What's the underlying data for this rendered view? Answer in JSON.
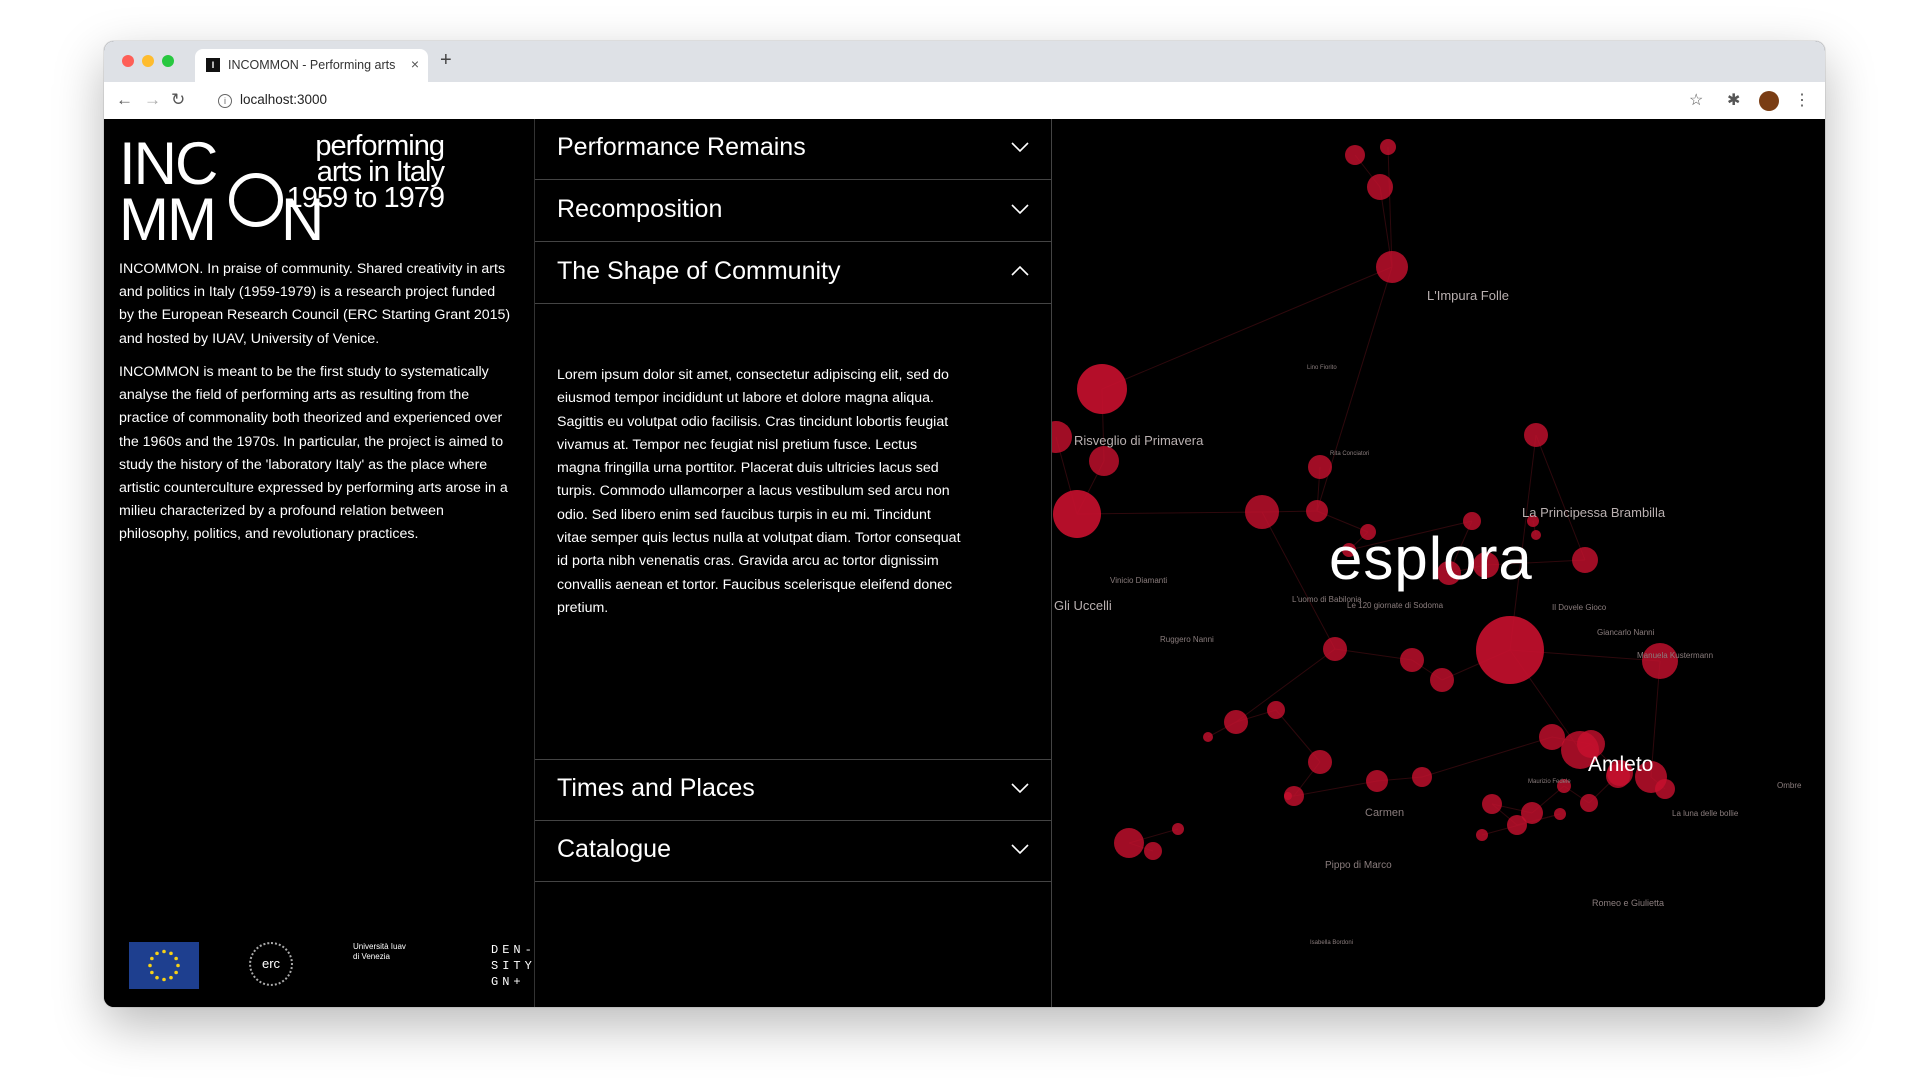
{
  "browser": {
    "tab_favicon": "I",
    "tab_title": "INCOMMON - Performing arts",
    "tab_close": "×",
    "new_tab": "+",
    "url": "localhost:3000"
  },
  "logo": {
    "line1": "INC",
    "line1b": "O",
    "line2a": "MM",
    "line2b": "N",
    "tagline": "performing arts in Italy 1959 to 1979"
  },
  "intro": {
    "paragraph1": "INCOMMON. In praise of community. Shared creativity in arts and politics in Italy (1959-1979) is a research project funded by the European Research Council (ERC Starting Grant 2015) and hosted by IUAV, University of Venice.",
    "paragraph2": "INCOMMON is meant to be the first study to systematically analyse the field of performing arts as resulting from the practice of commonality both theorized and experienced over the 1960s and the 1970s. In particular, the project is aimed to study the history of the 'laboratory Italy' as the place where artistic counterculture expressed by performing arts arose in a milieu characterized by a profound relation between philosophy, politics, and revolutionary practices."
  },
  "footer_logos": {
    "erc": "erc",
    "iuav_text": "Università Iuav di Venezia",
    "density": "DEN- SITY GN+"
  },
  "accordion": {
    "items": [
      {
        "title": "Performance Remains",
        "expanded": false
      },
      {
        "title": "Recomposition",
        "expanded": false
      },
      {
        "title": "The Shape of Community",
        "expanded": true
      },
      {
        "title": "Times and Places",
        "expanded": false
      },
      {
        "title": "Catalogue",
        "expanded": false
      }
    ],
    "open_body": "Lorem ipsum dolor sit amet, consectetur adipiscing elit, sed do eiusmod tempor incididunt ut labore et dolore magna aliqua. Sagittis eu volutpat odio facilisis. Cras tincidunt lobortis feugiat vivamus at. Tempor nec feugiat nisl pretium fusce. Lectus magna fringilla urna porttitor. Placerat duis ultricies lacus sed turpis. Commodo ullamcorper a lacus vestibulum sed arcu non odio. Sed libero enim sed faucibus turpis in eu mi. Tincidunt vitae semper quis lectus nulla at volutpat diam. Tortor consequat id porta nibh venenatis cras. Gravida arcu ac tortor dignissim convallis aenean et tortor. Faucibus scelerisque eleifend donec pretium."
  },
  "map": {
    "cta": "esplora",
    "node_color": "#c8102e",
    "labels": {
      "impura": "L'Impura Folle",
      "risveglio": "Risveglio di Primavera",
      "principessa": "La Principessa Brambilla",
      "uccelli": "Gli Uccelli",
      "amleto": "Amleto",
      "carmen": "Carmen",
      "pippo": "Pippo di Marco",
      "romeo": "Romeo e Giulietta",
      "vinicio": "Vinicio Diamanti",
      "giornate": "Le 120 giornate di Sodoma",
      "manuela": "Manuela Kustermann",
      "giancarlo": "Giancarlo Nanni",
      "dovele": "Il Dovele Gioco",
      "luomo": "L'uomo di Babilonia",
      "ruggero": "Ruggero Nanni",
      "ombre": "Ombre",
      "laluna": "La luna delle bollie",
      "small1": "Lino Fiorito",
      "small2": "Rita Conciatori",
      "small3": "Maurizio Fedele",
      "small4": "Isabella Bordoni"
    }
  }
}
